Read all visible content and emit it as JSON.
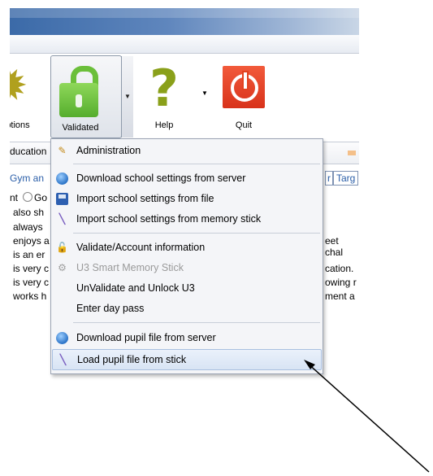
{
  "toolbar": {
    "options_label": "ptions",
    "validated_label": "Validated",
    "help_label": "Help",
    "quit_label": "Quit"
  },
  "tabs": {
    "left_tab": "ducation",
    "subtab_left": "Gym an",
    "subtab_r1": "r",
    "subtab_r2": "Targ"
  },
  "radios": {
    "item1": "nt",
    "item2": "Go"
  },
  "content_lines": [
    {
      "left": "also sh",
      "right": ""
    },
    {
      "left": "always",
      "right": ""
    },
    {
      "left": "enjoys a",
      "right": "eet chal"
    },
    {
      "left": "is an er",
      "right": ""
    },
    {
      "left": "is very c",
      "right": "cation."
    },
    {
      "left": "is very c",
      "right": "owing r"
    },
    {
      "left": "works h",
      "right": "ment a"
    }
  ],
  "menu": {
    "items": [
      {
        "label": "Administration",
        "icon": "tools-icon",
        "enabled": true
      },
      {
        "label": "Download school settings from server",
        "icon": "globe-icon",
        "enabled": true
      },
      {
        "label": "Import school settings from file",
        "icon": "floppy-disk-icon",
        "enabled": true
      },
      {
        "label": "Import school settings from memory stick",
        "icon": "memory-stick-icon",
        "enabled": true
      },
      {
        "label": "Validate/Account information",
        "icon": "unlock-icon",
        "enabled": true
      },
      {
        "label": "U3 Smart Memory Stick",
        "icon": "usb-icon",
        "enabled": false
      },
      {
        "label": "UnValidate and Unlock U3",
        "icon": "",
        "enabled": true
      },
      {
        "label": "Enter day pass",
        "icon": "",
        "enabled": true
      },
      {
        "label": "Download pupil file from server",
        "icon": "globe-icon",
        "enabled": true
      },
      {
        "label": "Load pupil file from stick",
        "icon": "memory-stick-icon",
        "enabled": true,
        "highlighted": true
      }
    ]
  },
  "colors": {
    "title_gradient_start": "#3b6aa8",
    "validated_green": "#6bbf3a",
    "help_green": "#8aa01a",
    "quit_red": "#e2421f",
    "menu_bg": "#f4f5f8",
    "highlight": "#d8e4f4"
  }
}
